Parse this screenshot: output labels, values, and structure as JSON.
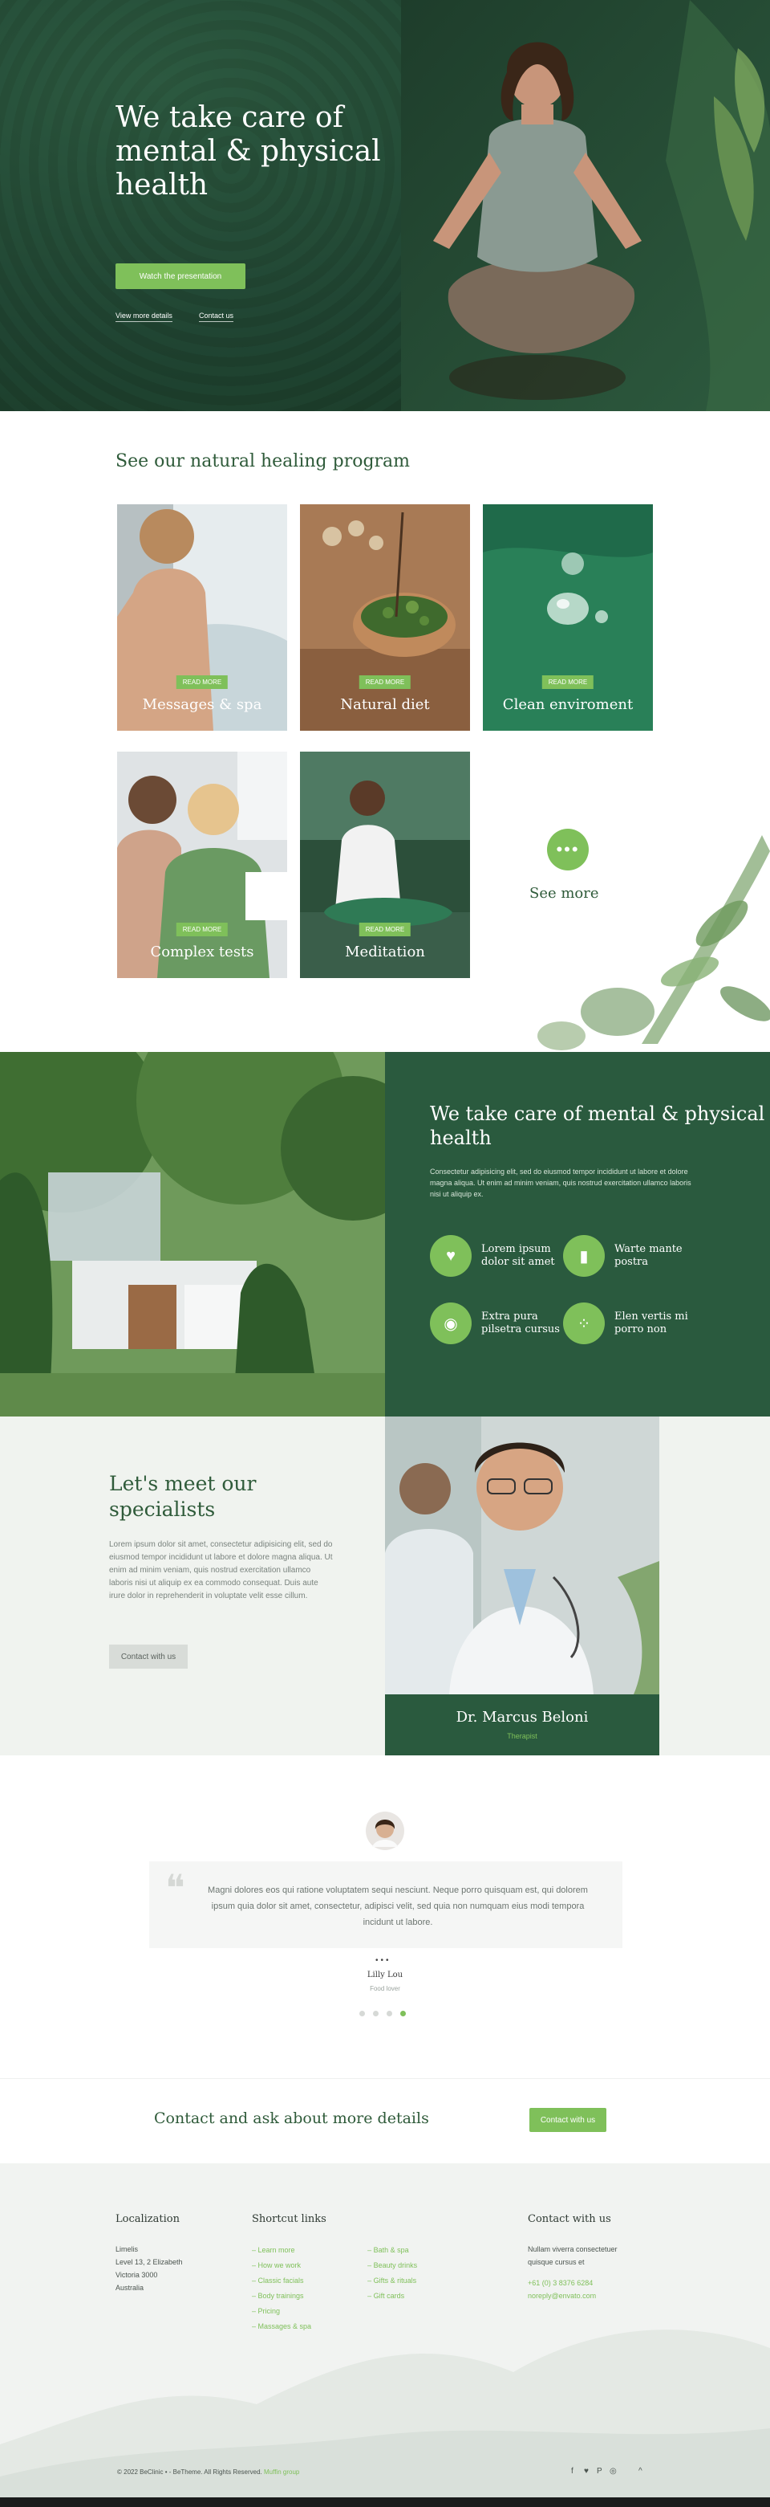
{
  "hero": {
    "title": "We take care of mental & physical health",
    "primary_button": "Watch the presentation",
    "link_more": "View more details",
    "link_contact": "Contact us"
  },
  "program": {
    "title": "See our natural healing program",
    "badge": "READ MORE",
    "cards": [
      {
        "label": "Messages & spa"
      },
      {
        "label": "Natural diet"
      },
      {
        "label": "Clean enviroment"
      },
      {
        "label": "Complex tests"
      },
      {
        "label": "Meditation"
      }
    ],
    "see_more": "See more"
  },
  "care": {
    "title": "We take care of mental & physical health",
    "description": "Consectetur adipisicing elit, sed do eiusmod tempor incididunt ut labore et dolore magna aliqua. Ut enim ad minim veniam, quis nostrud exercitation ullamco laboris nisi ut aliquip ex.",
    "features": [
      {
        "label": "Lorem ipsum dolor sit amet",
        "icon": "heart-leaf-icon"
      },
      {
        "label": "Warte mante postra",
        "icon": "bottle-icon"
      },
      {
        "label": "Extra pura pilsetra cursus",
        "icon": "plate-icon"
      },
      {
        "label": "Elen vertis mi porro non",
        "icon": "dots-icon"
      }
    ]
  },
  "specialists": {
    "title": "Let's meet our specialists",
    "description": "Lorem ipsum dolor sit amet, consectetur adipisicing elit, sed do eiusmod tempor incididunt ut labore et dolore magna aliqua. Ut enim ad minim veniam, quis nostrud exercitation ullamco laboris nisi ut aliquip ex ea commodo consequat. Duis aute irure dolor in reprehenderit in voluptate velit esse cillum.",
    "button": "Contact with us",
    "doctor_name": "Dr. Marcus Beloni",
    "doctor_role": "Therapist"
  },
  "testimonial": {
    "quote": "Magni dolores eos qui ratione voluptatem sequi nesciunt. Neque porro quisquam est, qui dolorem ipsum quia dolor sit amet, consectetur, adipisci velit, sed quia non numquam eius modi tempora incidunt ut labore.",
    "name": "Lilly Lou",
    "role": "Food lover"
  },
  "contact_bar": {
    "title": "Contact and ask about more details",
    "button": "Contact with us"
  },
  "footer": {
    "col1_title": "Localization",
    "col1_lines": [
      "Limelis",
      "Level 13, 2 Elizabeth",
      "Victoria 3000",
      "Australia"
    ],
    "col2_title": "Shortcut links",
    "links_a": [
      "Learn more",
      "How we work",
      "Classic facials",
      "Body trainings",
      "Pricing",
      "Massages & spa"
    ],
    "links_b": [
      "Bath & spa",
      "Beauty drinks",
      "Gifts & rituals",
      "Gift cards"
    ],
    "col3_title": "Contact with us",
    "col3_lines": [
      "Nullam viverra consectetuer",
      "quisque cursus et"
    ],
    "phone": "+61 (0) 3 8376 6284",
    "email": "noreply@envato.com",
    "copyright_a": "© 2022 BeClinic • - BeTheme. All Rights Reserved.",
    "copyright_b": "Muffin group",
    "social": [
      "f",
      "♥",
      "P",
      "◎",
      "^"
    ]
  },
  "colors": {
    "accent": "#7fc05a",
    "dark_green": "#2a5a3e",
    "title_green": "#2f5b3a"
  }
}
